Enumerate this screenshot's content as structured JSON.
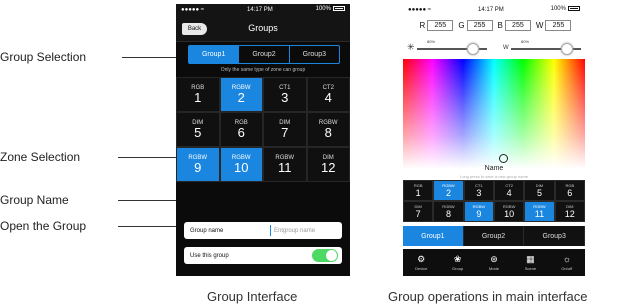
{
  "callouts": {
    "group_selection": "Group Selection",
    "zone_selection": "Zone Selection",
    "group_name": "Group Name",
    "open_group": "Open the Group"
  },
  "captions": {
    "left": "Group Interface",
    "right": "Group operations in main interface"
  },
  "phone1": {
    "status": {
      "carrier": "●●●●● ≈",
      "time": "14:17 PM",
      "battery": "100%"
    },
    "back_label": "Back",
    "title": "Groups",
    "groups": [
      {
        "label": "Group1",
        "active": true
      },
      {
        "label": "Group2",
        "active": false
      },
      {
        "label": "Group3",
        "active": false
      }
    ],
    "hint": "Only the same type of zone can group",
    "zones": [
      {
        "type": "RGB",
        "num": "1",
        "sel": false
      },
      {
        "type": "RGBW",
        "num": "2",
        "sel": true
      },
      {
        "type": "CT1",
        "num": "3",
        "sel": false
      },
      {
        "type": "CT2",
        "num": "4",
        "sel": false
      },
      {
        "type": "DIM",
        "num": "5",
        "sel": false
      },
      {
        "type": "RGB",
        "num": "6",
        "sel": false
      },
      {
        "type": "DIM",
        "num": "7",
        "sel": false
      },
      {
        "type": "RGBW",
        "num": "8",
        "sel": false
      },
      {
        "type": "RGBW",
        "num": "9",
        "sel": true
      },
      {
        "type": "RGBW",
        "num": "10",
        "sel": true
      },
      {
        "type": "RGBW",
        "num": "11",
        "sel": false
      },
      {
        "type": "DIM",
        "num": "12",
        "sel": false
      }
    ],
    "group_name_label": "Group name",
    "group_name_placeholder": "Entgroup name",
    "use_group_label": "Use this group",
    "use_group_on": true
  },
  "phone2": {
    "status": {
      "carrier": "●●●●● ≈",
      "time": "14:17 PM",
      "battery": "100%"
    },
    "rgbw": [
      {
        "label": "R",
        "value": "255"
      },
      {
        "label": "G",
        "value": "255"
      },
      {
        "label": "B",
        "value": "255"
      },
      {
        "label": "W",
        "value": "255"
      }
    ],
    "brightness_pct": "80%",
    "white_label": "W",
    "white_pct": "80%",
    "brightness_level": 0.8,
    "white_level": 0.8,
    "name_label": "Name",
    "name_sub": "Long press to save a new group name",
    "zones": [
      {
        "type": "RGB",
        "num": "1",
        "sel": false
      },
      {
        "type": "RGBW",
        "num": "2",
        "sel": true
      },
      {
        "type": "CT1",
        "num": "3",
        "sel": false
      },
      {
        "type": "CT2",
        "num": "4",
        "sel": false
      },
      {
        "type": "DIM",
        "num": "5",
        "sel": false
      },
      {
        "type": "RGB",
        "num": "6",
        "sel": false
      },
      {
        "type": "DIM",
        "num": "7",
        "sel": false
      },
      {
        "type": "RGBW",
        "num": "8",
        "sel": false
      },
      {
        "type": "RGBW",
        "num": "9",
        "sel": true
      },
      {
        "type": "RGBW",
        "num": "10",
        "sel": false
      },
      {
        "type": "RGBW",
        "num": "11",
        "sel": true
      },
      {
        "type": "DIM",
        "num": "12",
        "sel": false
      }
    ],
    "groups": [
      {
        "label": "Group1",
        "active": true
      },
      {
        "label": "Group2",
        "active": false
      },
      {
        "label": "Group3",
        "active": false
      }
    ],
    "tabs": [
      {
        "label": "Device",
        "icon": "gear-icon",
        "glyph": "⚙"
      },
      {
        "label": "Group",
        "icon": "group-icon",
        "glyph": "❀"
      },
      {
        "label": "Mode",
        "icon": "mode-icon",
        "glyph": "⊛"
      },
      {
        "label": "Scene",
        "icon": "scene-icon",
        "glyph": "▦"
      },
      {
        "label": "On/off",
        "icon": "bulb-icon",
        "glyph": "☼"
      }
    ]
  },
  "colors": {
    "accent": "#1a86e0",
    "toggle_on": "#4cd964"
  }
}
